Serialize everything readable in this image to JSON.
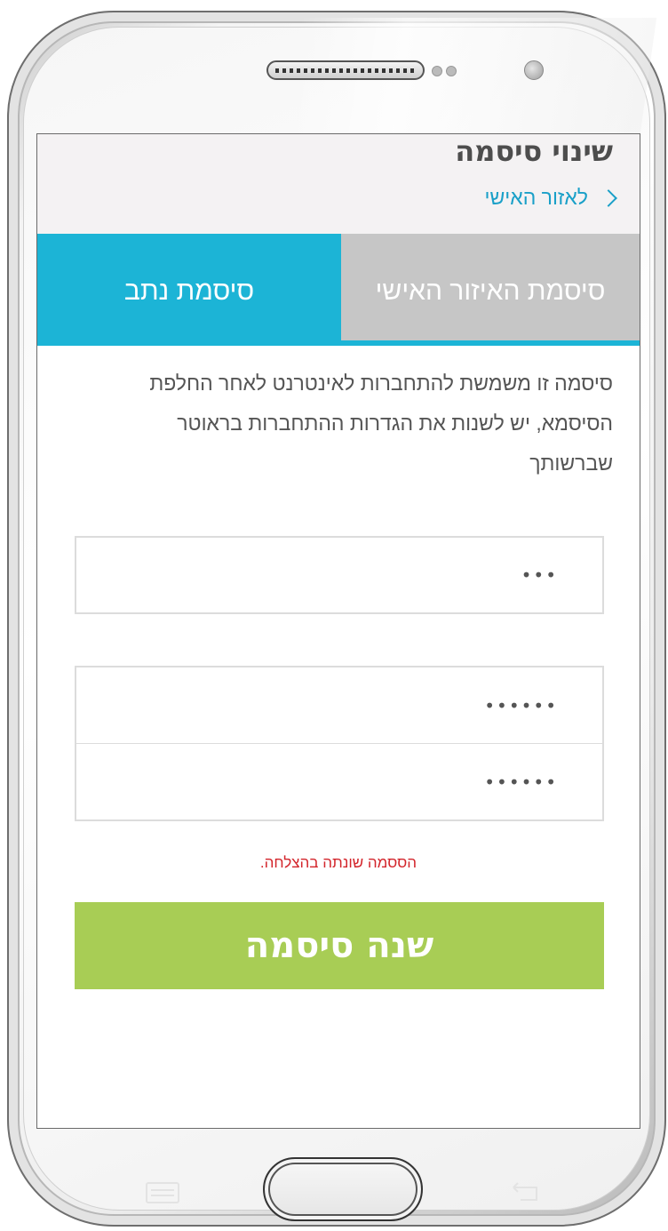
{
  "header": {
    "title": "שינוי סיסמה",
    "breadcrumb_label": "לאזור האישי"
  },
  "tabs": [
    {
      "label": "סיסמת האיזור האישי",
      "active": false
    },
    {
      "label": "סיסמת נתב",
      "active": true
    }
  ],
  "description": "סיסמה זו משמשת להתחברות לאינטרנט לאחר החלפת הסיסמא, יש לשנות את הגדרות ההתחברות בראוטר שברשותך",
  "form": {
    "current_password_value": "•••",
    "new_password_value": "••••••",
    "confirm_password_value": "••••••",
    "status_message": "הססמה שונתה בהצלחה.",
    "submit_label": "שנה סיסמה"
  },
  "colors": {
    "accent": "#1cb4d6",
    "tab_inactive": "#c6c6c6",
    "submit": "#a8cd55",
    "status_success_text": "#d3252b",
    "link": "#1aa0c8"
  },
  "icons": {
    "breadcrumb": "chevron-right-icon",
    "nav_menu": "menu-icon",
    "nav_back": "back-icon"
  }
}
